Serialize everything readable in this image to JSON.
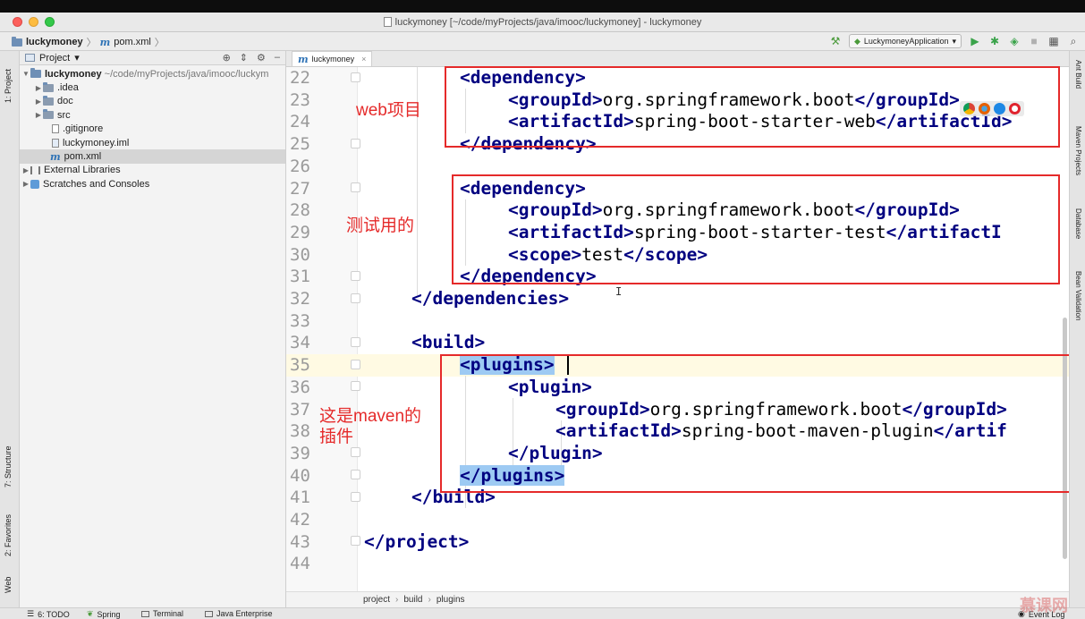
{
  "window": {
    "title": "luckymoney [~/code/myProjects/java/imooc/luckymoney] - luckymoney"
  },
  "navbar": {
    "project": "luckymoney",
    "file": "pom.xml",
    "run_config": "LuckymoneyApplication"
  },
  "left_tabs": {
    "project": "1: Project",
    "structure": "7: Structure",
    "favorites": "2: Favorites",
    "web": "Web"
  },
  "right_tabs": {
    "ant": "Ant Build",
    "maven": "Maven Projects",
    "database": "Database",
    "bean": "Bean Validation"
  },
  "project_panel": {
    "title": "Project",
    "root_name": "luckymoney",
    "root_path": "~/code/myProjects/java/imooc/luckym",
    "items": [
      {
        "label": "luckymoney ~/code/myProjects/java/imooc/luckym",
        "icon": "folder-icon"
      },
      {
        "label": ".idea",
        "icon": "folder-icon"
      },
      {
        "label": "doc",
        "icon": "folder-icon"
      },
      {
        "label": "src",
        "icon": "folder-icon"
      },
      {
        "label": ".gitignore",
        "icon": "file-icon"
      },
      {
        "label": "luckymoney.iml",
        "icon": "file-icon"
      },
      {
        "label": "pom.xml",
        "icon": "maven-icon"
      },
      {
        "label": "External Libraries",
        "icon": "library-icon"
      },
      {
        "label": "Scratches and Consoles",
        "icon": "scratch-icon"
      }
    ]
  },
  "editor": {
    "tab": "luckymoney",
    "current_line": 35,
    "line_numbers": [
      "22",
      "23",
      "24",
      "25",
      "26",
      "27",
      "28",
      "29",
      "30",
      "31",
      "32",
      "33",
      "34",
      "35",
      "36",
      "37",
      "38",
      "39",
      "40",
      "41",
      "42",
      "43",
      "44"
    ],
    "code": {
      "l22": "<dependency>",
      "l23_open": "<groupId>",
      "l23_text": "org.springframework.boot",
      "l23_close": "</groupId>",
      "l24_open": "<artifactId>",
      "l24_text": "spring-boot-starter-web",
      "l24_close": "</artifactId>",
      "l25": "</dependency>",
      "l27": "<dependency>",
      "l28_open": "<groupId>",
      "l28_text": "org.springframework.boot",
      "l28_close": "</groupId>",
      "l29_open": "<artifactId>",
      "l29_text": "spring-boot-starter-test",
      "l29_close": "</artifactI",
      "l30_open": "<scope>",
      "l30_text": "test",
      "l30_close": "</scope>",
      "l31": "</dependency>",
      "l32": "</dependencies>",
      "l34": "<build>",
      "l35": "<plugins>",
      "l36": "<plugin>",
      "l37_open": "<groupId>",
      "l37_text": "org.springframework.boot",
      "l37_close": "</groupId>",
      "l38_open": "<artifactId>",
      "l38_text": "spring-boot-maven-plugin",
      "l38_close": "</artif",
      "l39": "</plugin>",
      "l40": "</plugins>",
      "l41": "</build>",
      "l43": "</project>"
    },
    "breadcrumb": [
      "project",
      "build",
      "plugins"
    ]
  },
  "annotations": {
    "web": "web项目",
    "test": "测试用的",
    "maven_line1": "这是maven的",
    "maven_line2": "插件"
  },
  "bottom_tabs": {
    "todo": "6: TODO",
    "spring": "Spring",
    "terminal": "Terminal",
    "java_ee": "Java Enterprise",
    "event_log": "Event Log"
  },
  "watermark": "慕课网",
  "colors": {
    "annotation_red": "#e52a2a",
    "xml_tag": "#000080",
    "selection": "#9dcaf3",
    "caret_line": "#fffae3"
  }
}
